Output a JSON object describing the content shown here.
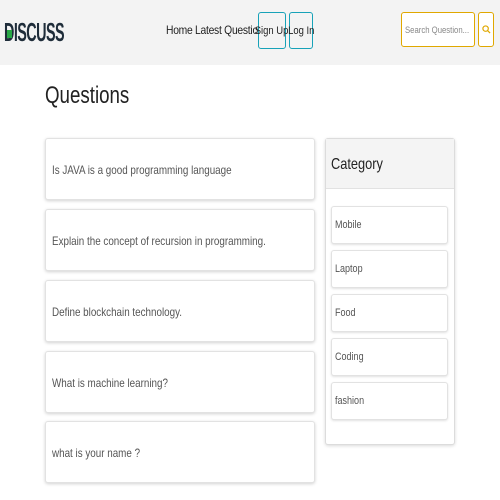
{
  "header": {
    "logo_text": "DISCUSS",
    "nav": {
      "home": "Home",
      "latest_questions": "Latest Questions",
      "sign_up": "Sign Up",
      "log_in": "Log In"
    },
    "search": {
      "placeholder": "Search Question..."
    }
  },
  "main": {
    "title": "Questions",
    "questions": [
      "Is JAVA is a good programming language",
      "Explain the concept of recursion in programming.",
      "Define blockchain technology.",
      "What is machine learning?",
      "what is your name ?"
    ]
  },
  "sidebar": {
    "title": "Category",
    "categories": [
      "Mobile",
      "Laptop",
      "Food",
      "Coding",
      "fashion"
    ]
  },
  "colors": {
    "logo_dark": "#1f2d3a",
    "logo_accent": "#28a745",
    "nav_button_border": "#17a2b8",
    "search_border": "#e0a800",
    "header_bg": "#f3f3f3"
  }
}
